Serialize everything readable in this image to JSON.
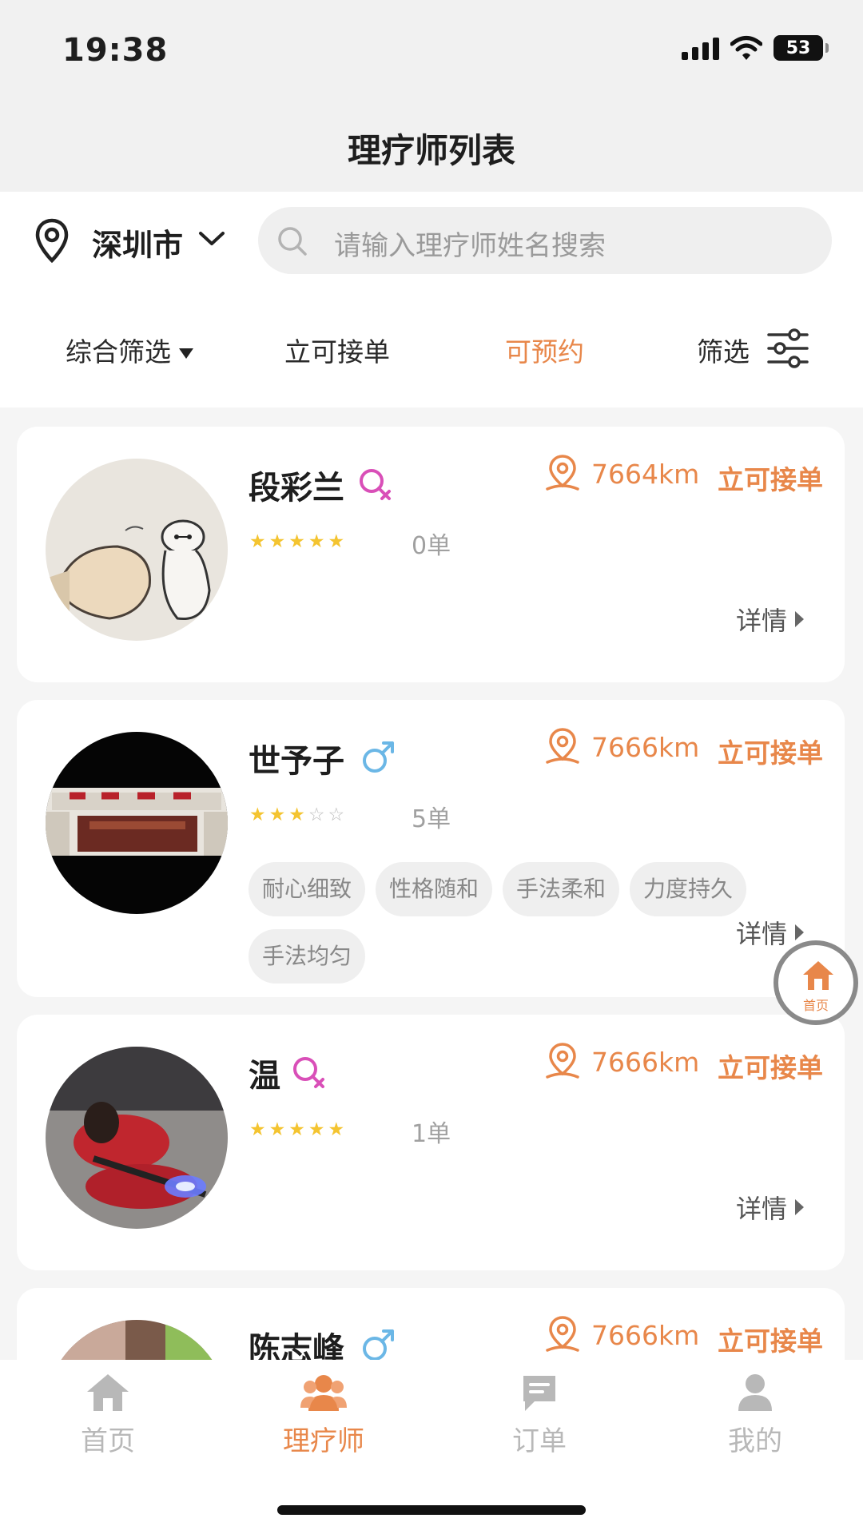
{
  "status_bar": {
    "time": "19:38",
    "battery": "53"
  },
  "title": "理疗师列表",
  "location": {
    "city": "深圳市"
  },
  "search": {
    "placeholder": "请输入理疗师姓名搜索"
  },
  "filters": [
    {
      "label": "综合筛选"
    },
    {
      "label": "立可接单"
    },
    {
      "label": "可预约"
    },
    {
      "label": "筛选"
    }
  ],
  "therapists": [
    {
      "name": "段彩兰",
      "gender": "female",
      "rating": 5,
      "orders": "0单",
      "distance": "7664km",
      "status": "立可接单",
      "tags": [],
      "detail": "详情"
    },
    {
      "name": "世予子",
      "gender": "male",
      "rating": 3,
      "orders": "5单",
      "distance": "7666km",
      "status": "立可接单",
      "tags": [
        "耐心细致",
        "性格随和",
        "手法柔和",
        "力度持久",
        "手法均匀"
      ],
      "detail": "详情"
    },
    {
      "name": "温",
      "gender": "female",
      "rating": 5,
      "orders": "1单",
      "distance": "7666km",
      "status": "立可接单",
      "tags": [],
      "detail": "详情"
    },
    {
      "name": "陈志峰",
      "gender": "male",
      "distance": "7666km",
      "status": "立可接单"
    }
  ],
  "float_button": {
    "label": "首页"
  },
  "tabs": [
    {
      "label": "首页",
      "icon": "home-icon"
    },
    {
      "label": "理疗师",
      "icon": "therapist-icon"
    },
    {
      "label": "订单",
      "icon": "order-icon"
    },
    {
      "label": "我的",
      "icon": "profile-icon"
    }
  ],
  "colors": {
    "accent": "#e8874a",
    "male": "#6bb7e6",
    "female": "#d94fb8",
    "star": "#f4c430"
  }
}
